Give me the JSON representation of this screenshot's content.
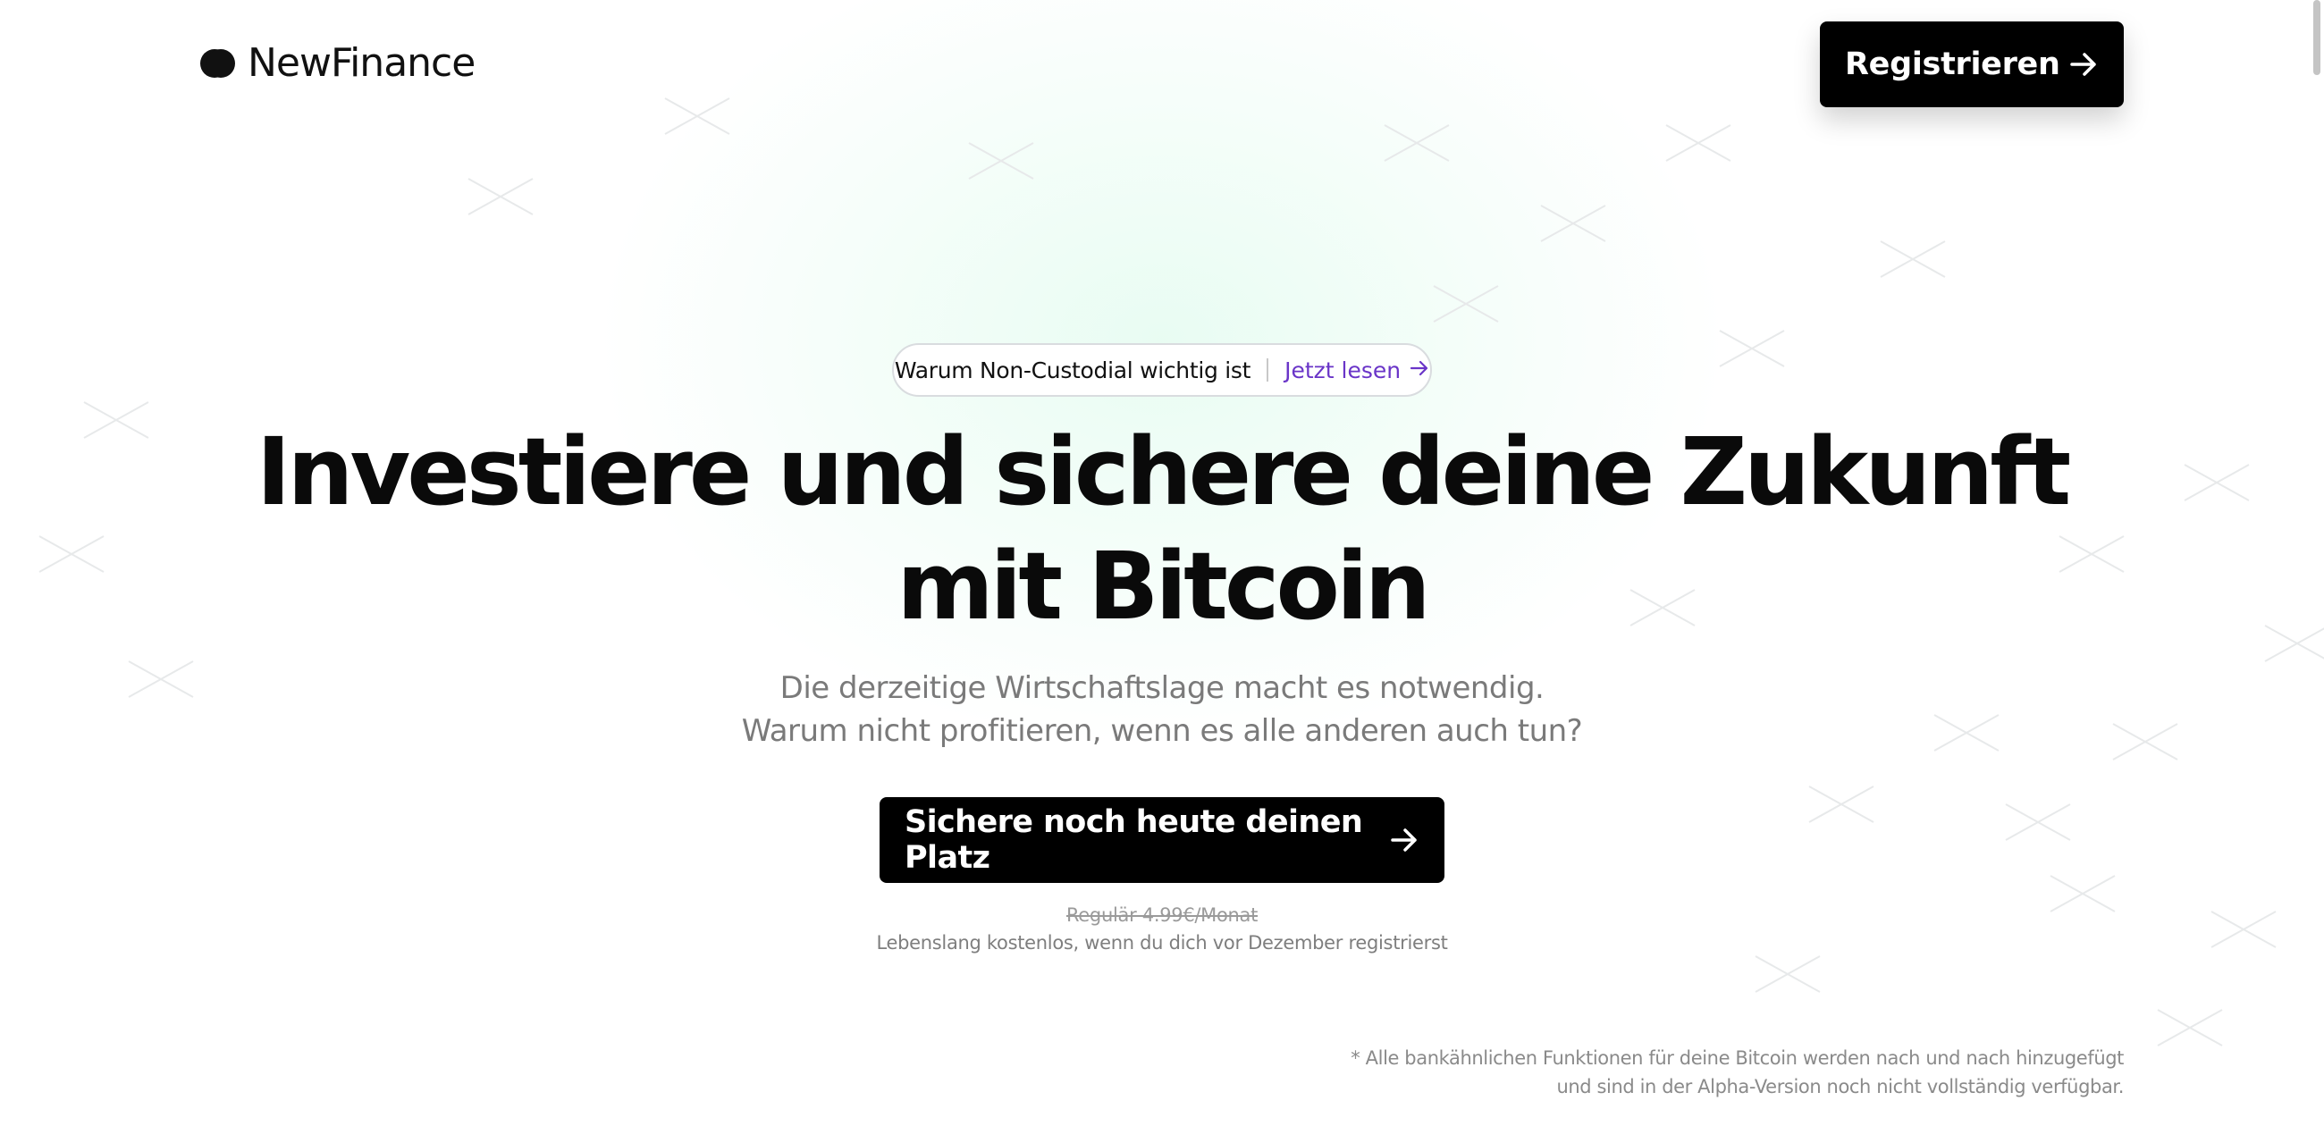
{
  "header": {
    "logo_text": "NewFinance",
    "register_label": "Registrieren"
  },
  "pill": {
    "text": "Warum Non-Custodial wichtig ist",
    "link_label": "Jetzt lesen",
    "link_color": "#6a35c8"
  },
  "hero": {
    "headline_line1": "Investiere und sichere deine Zukunft",
    "headline_line2": "mit Bitcoin",
    "subtitle_line1": "Die derzeitige Wirtschaftslage macht es notwendig.",
    "subtitle_line2": "Warum nicht profitieren, wenn es alle anderen auch tun?",
    "cta_label": "Sichere noch heute deinen Platz"
  },
  "pricing": {
    "regular_price": "Regulär 4.99€/Monat",
    "note": "Lebenslang kostenlos, wenn du dich vor Dezember registrierst"
  },
  "footnote": {
    "line1": "* Alle bankähnlichen Funktionen für deine Bitcoin werden nach und nach hinzugefügt",
    "line2": "und sind in der Alpha-Version noch nicht vollständig verfügbar."
  },
  "icons": {
    "logo": "newfinance-logo-icon",
    "register_arrow": "arrow-right-icon",
    "pill_arrow": "arrow-right-icon",
    "cta_arrow": "arrow-right-icon"
  },
  "colors": {
    "primary": "#000000",
    "accent": "#6a35c8",
    "muted_text": "#7a7a7a",
    "glow": "#d6fae8"
  }
}
